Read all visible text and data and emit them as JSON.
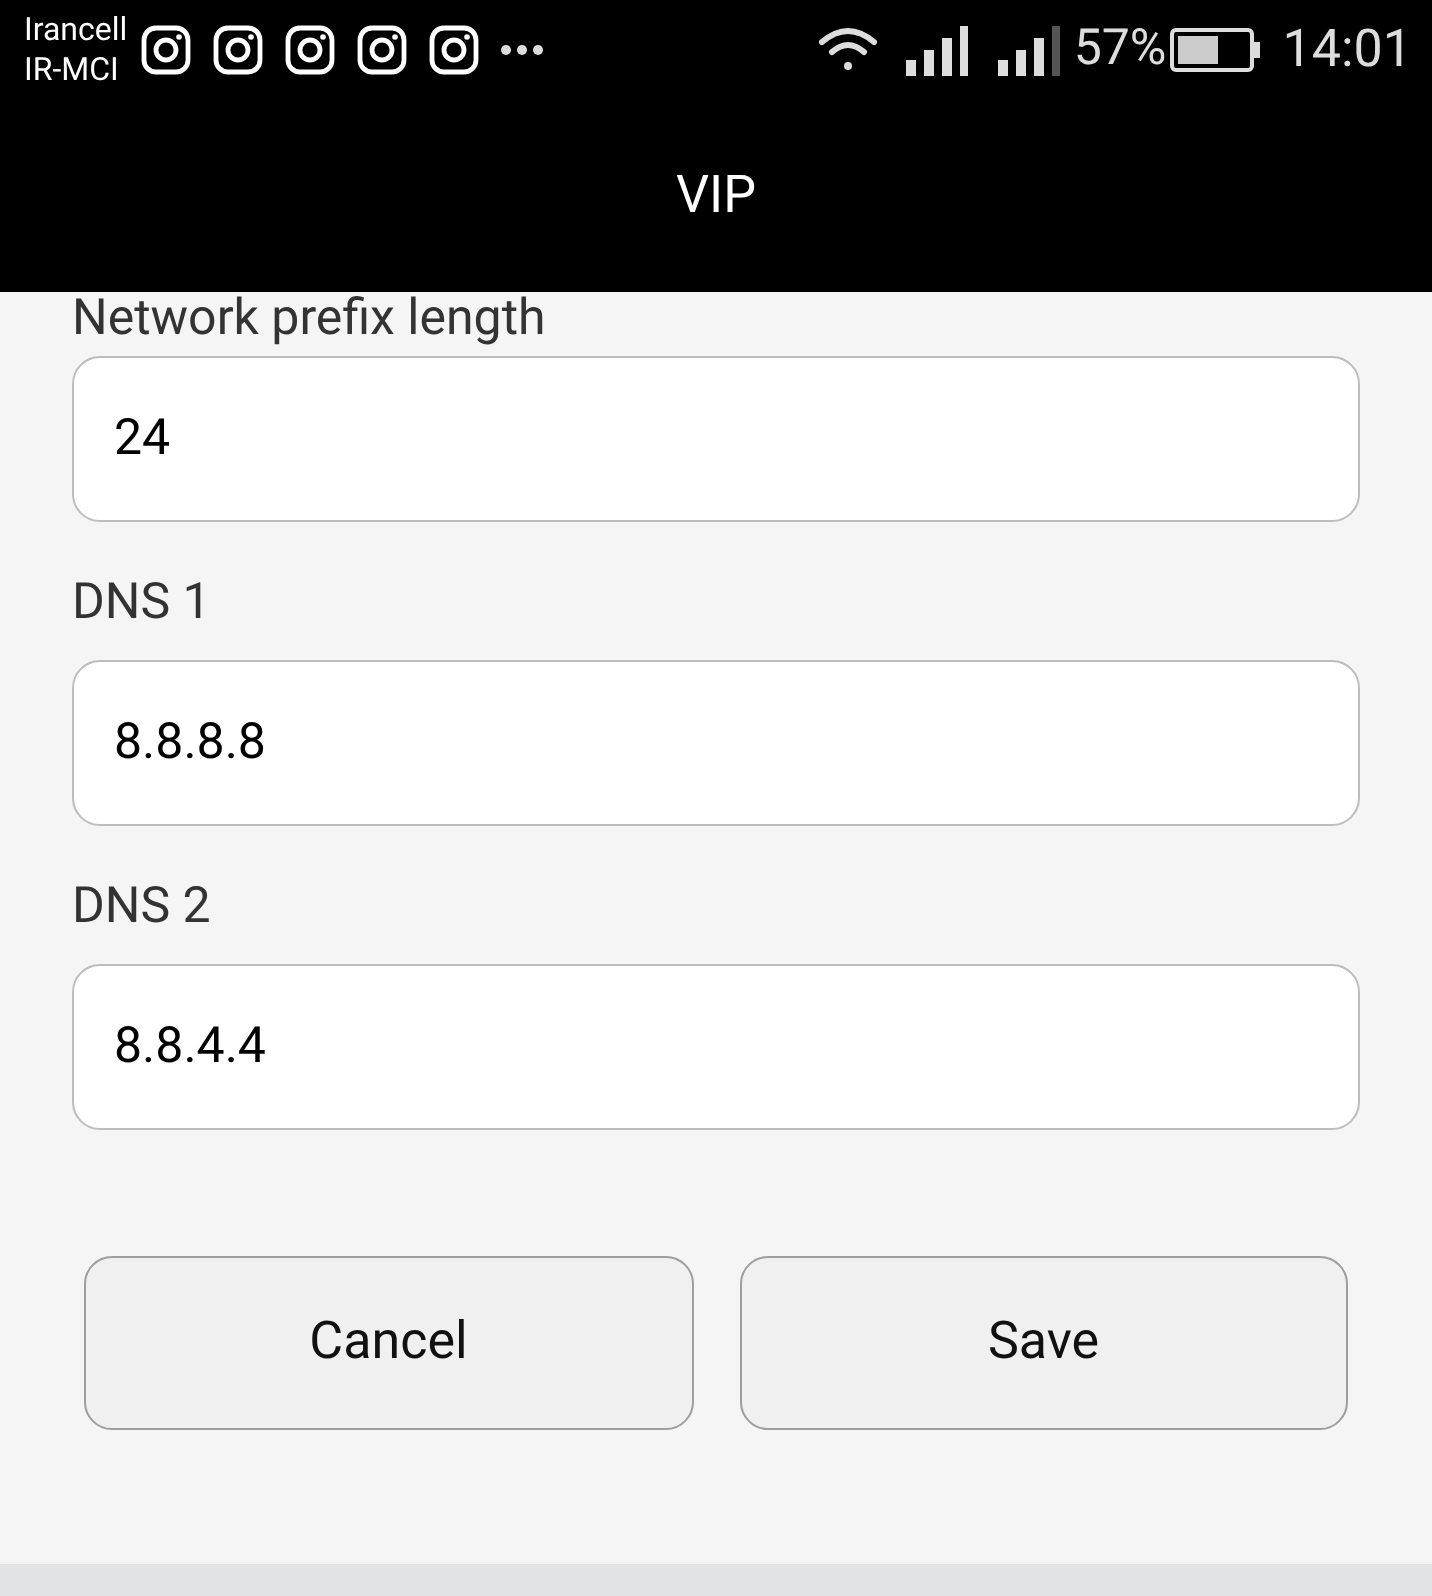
{
  "status_bar": {
    "carriers": [
      "Irancell",
      "IR-MCI"
    ],
    "battery": "57%",
    "time": "14:01"
  },
  "title": "VIP",
  "fields": [
    {
      "label": "Network prefix length",
      "value": "24"
    },
    {
      "label": "DNS 1",
      "value": "8.8.8.8"
    },
    {
      "label": "DNS 2",
      "value": "8.8.4.4"
    }
  ],
  "buttons": [
    "Cancel",
    "Save"
  ]
}
